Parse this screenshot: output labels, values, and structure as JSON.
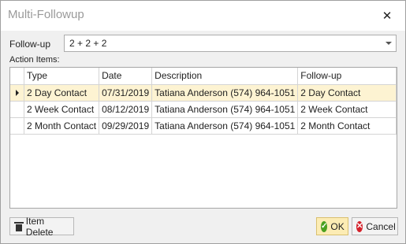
{
  "window": {
    "title": "Multi-Followup"
  },
  "followup": {
    "label": "Follow-up",
    "value": "2 + 2 + 2"
  },
  "action_items": {
    "label": "Action Items:",
    "columns": [
      "Type",
      "Date",
      "Description",
      "Follow-up"
    ],
    "rows": [
      {
        "type": "2 Day Contact",
        "date": "07/31/2019",
        "description": "Tatiana Anderson (574) 964-1051",
        "followup": "2 Day Contact"
      },
      {
        "type": "2 Week Contact",
        "date": "08/12/2019",
        "description": "Tatiana Anderson (574) 964-1051",
        "followup": "2 Week Contact"
      },
      {
        "type": "2 Month Contact",
        "date": "09/29/2019",
        "description": "Tatiana Anderson (574) 964-1051",
        "followup": "2 Month Contact"
      }
    ]
  },
  "buttons": {
    "item_delete": "Item Delete",
    "ok": "OK",
    "cancel": "Cancel"
  },
  "icons": {
    "close": "close-icon",
    "dropdown": "chevron-down-icon",
    "delete": "trash-icon",
    "ok": "check-icon",
    "cancel": "cancel-icon",
    "row_indicator": "row-pointer-icon"
  },
  "colors": {
    "selected_row": "#fdf3d2",
    "ok_button": "#fcecb4",
    "ok_icon": "#4aa01f",
    "cancel_icon": "#d4212a"
  }
}
